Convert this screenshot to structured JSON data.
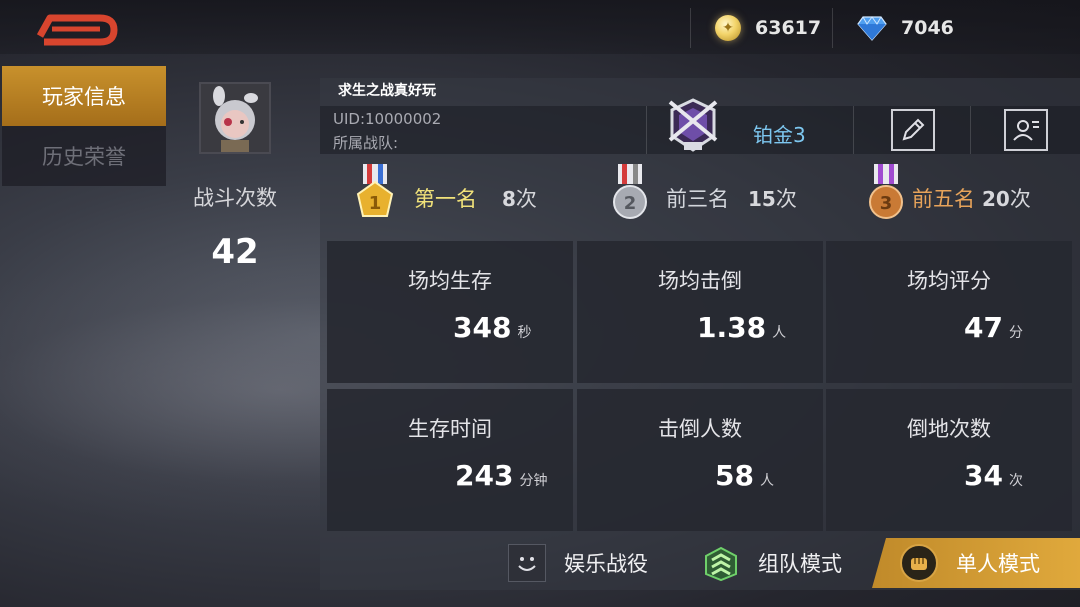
{
  "currencies": {
    "gold": {
      "value": "63617",
      "icon": "gold-coin-icon"
    },
    "diamond": {
      "value": "7046",
      "icon": "diamond-icon"
    }
  },
  "tabs": [
    {
      "label": "玩家信息",
      "active": true
    },
    {
      "label": "历史荣誉",
      "active": false
    }
  ],
  "profile": {
    "name": "求生之战真好玩",
    "uid": "UID:10000002",
    "team": "所属战队:",
    "rank": "铂金3",
    "battle_label": "战斗次数",
    "battle_count": "42"
  },
  "medals": [
    {
      "label": "第一名",
      "count": "8",
      "unit": "次",
      "color": "#f1e27a"
    },
    {
      "label": "前三名",
      "count": "15",
      "unit": "次",
      "color": "#d3d6dc"
    },
    {
      "label": "前五名",
      "count": "20",
      "unit": "次",
      "color": "#e7a35a"
    }
  ],
  "stats": [
    {
      "label": "场均生存",
      "value": "348",
      "unit": "秒"
    },
    {
      "label": "场均击倒",
      "value": "1.38",
      "unit": "人"
    },
    {
      "label": "场均评分",
      "value": "47",
      "unit": "分"
    },
    {
      "label": "生存时间",
      "value": "243",
      "unit": "分钟"
    },
    {
      "label": "击倒人数",
      "value": "58",
      "unit": "人"
    },
    {
      "label": "倒地次数",
      "value": "34",
      "unit": "次"
    }
  ],
  "modes": [
    {
      "label": "娱乐战役",
      "icon": "smiley-icon"
    },
    {
      "label": "组队模式",
      "icon": "squad-chevron-icon"
    },
    {
      "label": "单人模式",
      "icon": "fist-icon",
      "active": true
    }
  ]
}
